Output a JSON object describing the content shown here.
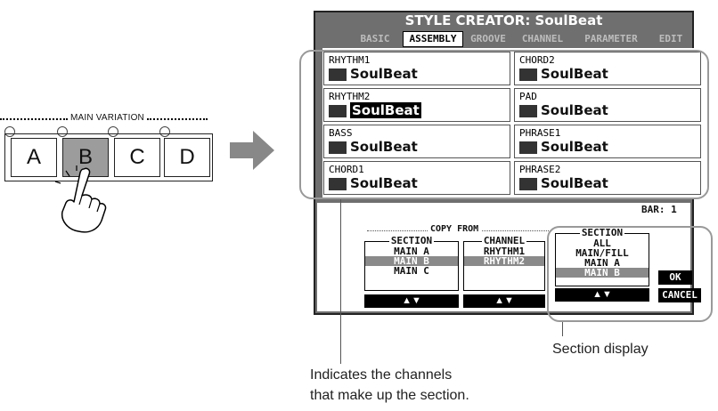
{
  "main_variation": {
    "title": "MAIN VARIATION",
    "buttons": [
      {
        "label": "A",
        "selected": false
      },
      {
        "label": "B",
        "selected": true
      },
      {
        "label": "C",
        "selected": false
      },
      {
        "label": "D",
        "selected": false
      }
    ]
  },
  "screen": {
    "title": "STYLE CREATOR: SoulBeat",
    "tabs": [
      "BASIC",
      "ASSEMBLY",
      "GROOVE",
      "CHANNEL",
      "PARAMETER",
      "EDIT"
    ],
    "active_tab": "ASSEMBLY",
    "channels": [
      {
        "label": "RHYTHM1",
        "value": "SoulBeat",
        "icon": "drum-icon"
      },
      {
        "label": "CHORD2",
        "value": "SoulBeat",
        "icon": "piano-icon"
      },
      {
        "label": "RHYTHM2",
        "value": "SoulBeat",
        "icon": "drum-icon",
        "selected": true
      },
      {
        "label": "PAD",
        "value": "SoulBeat",
        "icon": "keyboard-icon"
      },
      {
        "label": "BASS",
        "value": "SoulBeat",
        "icon": "bass-icon"
      },
      {
        "label": "PHRASE1",
        "value": "SoulBeat",
        "icon": "horn-icon"
      },
      {
        "label": "CHORD1",
        "value": "SoulBeat",
        "icon": "guitar-icon"
      },
      {
        "label": "PHRASE2",
        "value": "SoulBeat",
        "icon": "piano-icon"
      }
    ],
    "bar": "BAR: 1",
    "copy_from": {
      "title": "COPY FROM",
      "section_title": "SECTION",
      "section_items": [
        "MAIN A",
        "MAIN B",
        "MAIN C"
      ],
      "section_selected": "MAIN B",
      "channel_title": "CHANNEL",
      "channel_items": [
        "RHYTHM1",
        "RHYTHM2"
      ],
      "channel_selected": "RHYTHM2"
    },
    "section_panel": {
      "title": "SECTION",
      "items": [
        "ALL",
        "MAIN/FILL",
        "MAIN A",
        "MAIN B"
      ],
      "selected": "MAIN B",
      "ok": "OK",
      "cancel": "CANCEL"
    },
    "arrows": "▲▼"
  },
  "callouts": {
    "section_display": "Section display",
    "channels_line1": "Indicates the channels",
    "channels_line2": "that make up the section."
  }
}
